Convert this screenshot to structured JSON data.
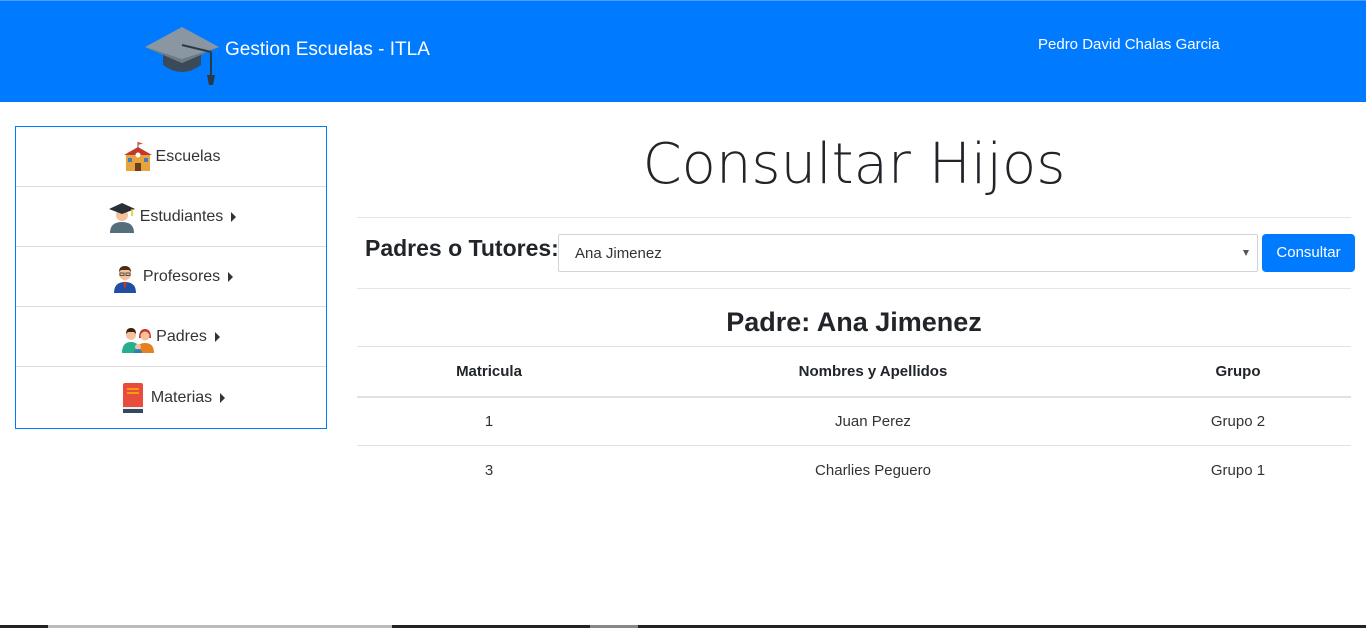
{
  "header": {
    "brand": "Gestion Escuelas - ITLA",
    "user": "Pedro David Chalas Garcia"
  },
  "sidebar": {
    "items": [
      {
        "label": "Escuelas",
        "icon": "school-icon",
        "has_submenu": false
      },
      {
        "label": "Estudiantes",
        "icon": "graduate-student-icon",
        "has_submenu": true
      },
      {
        "label": "Profesores",
        "icon": "teacher-icon",
        "has_submenu": true
      },
      {
        "label": "Padres",
        "icon": "parents-icon",
        "has_submenu": true
      },
      {
        "label": "Materias",
        "icon": "book-icon",
        "has_submenu": true
      }
    ]
  },
  "main": {
    "title": "Consultar Hijos",
    "form": {
      "label": "Padres o Tutores:",
      "selected": "Ana Jimenez",
      "button": "Consultar"
    },
    "parent": {
      "prefix": "Padre:",
      "name": "Ana Jimenez"
    },
    "table": {
      "headers": [
        "Matricula",
        "Nombres y Apellidos",
        "Grupo"
      ],
      "rows": [
        [
          "1",
          "Juan Perez",
          "Grupo 2"
        ],
        [
          "3",
          "Charlies Peguero",
          "Grupo 1"
        ]
      ]
    }
  },
  "colors": {
    "primary": "#007bff",
    "sidebar_border": "#007bff"
  }
}
